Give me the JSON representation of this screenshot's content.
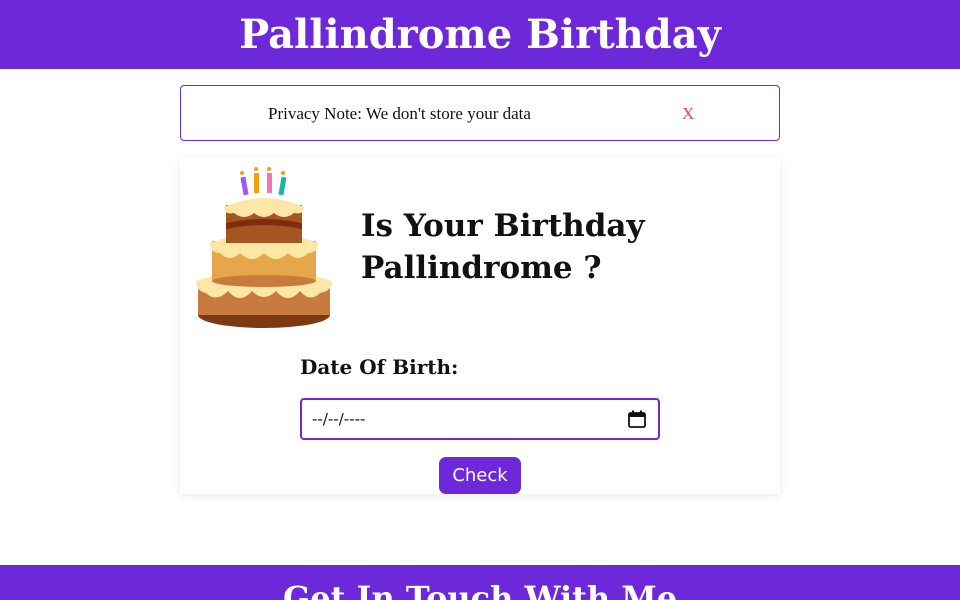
{
  "header": {
    "title": "Pallindrome Birthday"
  },
  "privacy": {
    "note": "Privacy Note: We don't store your data",
    "close": "X"
  },
  "card": {
    "title": "Is Your Birthday Pallindrome ?",
    "dob_label": "Date Of Birth:",
    "date_value": "--/--/----",
    "check_label": "Check"
  },
  "footer": {
    "title": "Get In Touch With Me"
  },
  "icons": {
    "cake": "birthday-cake-icon",
    "calendar": "calendar-icon"
  },
  "colors": {
    "brand": "#6d28d9",
    "close": "#ef4444",
    "text": "#111111"
  }
}
